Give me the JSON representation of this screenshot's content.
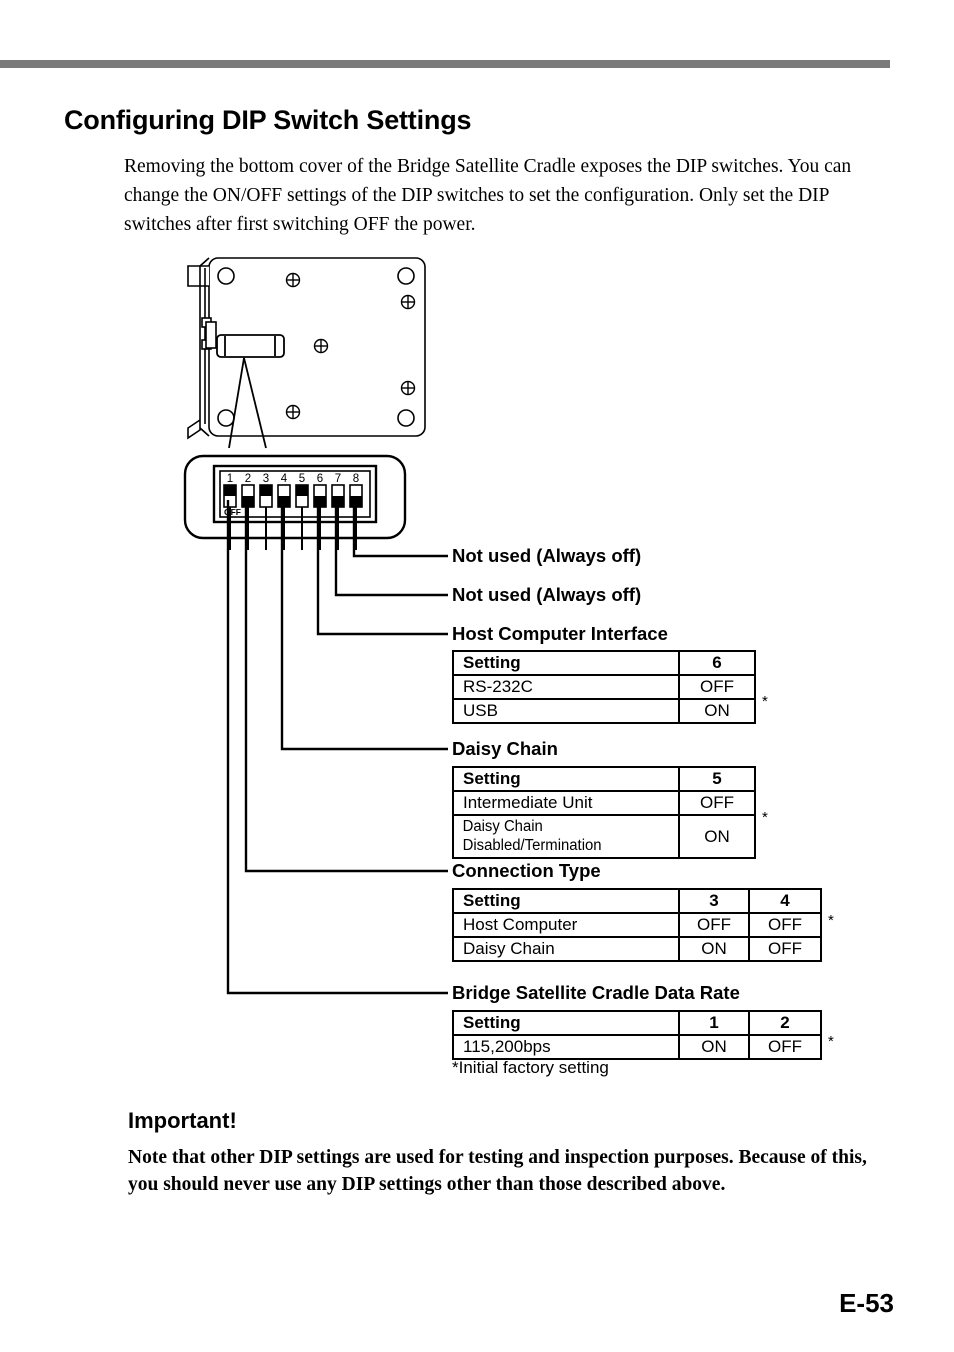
{
  "page": {
    "title": "Configuring DIP Switch Settings",
    "intro": "Removing the bottom cover of the Bridge Satellite Cradle exposes the DIP switches. You can change the ON/OFF settings of the DIP switches to set the configuration. Only set the DIP switches after first switching OFF the power.",
    "page_number": "E-53"
  },
  "dip_switch": {
    "off_label": "OFF",
    "numbers": [
      "1",
      "2",
      "3",
      "4",
      "5",
      "6",
      "7",
      "8"
    ],
    "positions": [
      "ON",
      "OFF",
      "ON",
      "OFF",
      "ON",
      "OFF",
      "OFF",
      "OFF"
    ]
  },
  "callouts": [
    {
      "id": "not-used-8",
      "label": "Not used (Always off)"
    },
    {
      "id": "not-used-7",
      "label": "Not used (Always off)"
    },
    {
      "id": "host-computer-interface",
      "label": "Host Computer Interface"
    },
    {
      "id": "daisy-chain",
      "label": "Daisy Chain"
    },
    {
      "id": "connection-type",
      "label": "Connection Type"
    },
    {
      "id": "data-rate",
      "label": "Bridge Satellite Cradle Data Rate"
    }
  ],
  "tables": {
    "host_computer_interface": {
      "headers": [
        "Setting",
        "6"
      ],
      "rows": [
        {
          "setting": "RS-232C",
          "values": [
            "OFF"
          ],
          "factory_default": false
        },
        {
          "setting": "USB",
          "values": [
            "ON"
          ],
          "factory_default": true
        }
      ]
    },
    "daisy_chain": {
      "headers": [
        "Setting",
        "5"
      ],
      "rows": [
        {
          "setting": "Intermediate Unit",
          "values": [
            "OFF"
          ],
          "factory_default": false
        },
        {
          "setting": "Daisy Chain Disabled/Termination",
          "values": [
            "ON"
          ],
          "factory_default": true
        }
      ]
    },
    "connection_type": {
      "headers": [
        "Setting",
        "3",
        "4"
      ],
      "rows": [
        {
          "setting": "Host Computer",
          "values": [
            "OFF",
            "OFF"
          ],
          "factory_default": true
        },
        {
          "setting": "Daisy Chain",
          "values": [
            "ON",
            "OFF"
          ],
          "factory_default": false
        }
      ]
    },
    "data_rate": {
      "headers": [
        "Setting",
        "1",
        "2"
      ],
      "rows": [
        {
          "setting": "115,200bps",
          "values": [
            "ON",
            "OFF"
          ],
          "factory_default": true
        }
      ]
    }
  },
  "footnote": "*Initial factory setting",
  "important": {
    "title": "Important!",
    "body": "Note that other DIP settings are used for testing and inspection purposes. Because of this, you should never use any DIP settings other than those described above."
  },
  "star_mark": "*",
  "colors": {
    "rule": "#7a7a7a",
    "ink": "#000000",
    "paper": "#ffffff"
  }
}
